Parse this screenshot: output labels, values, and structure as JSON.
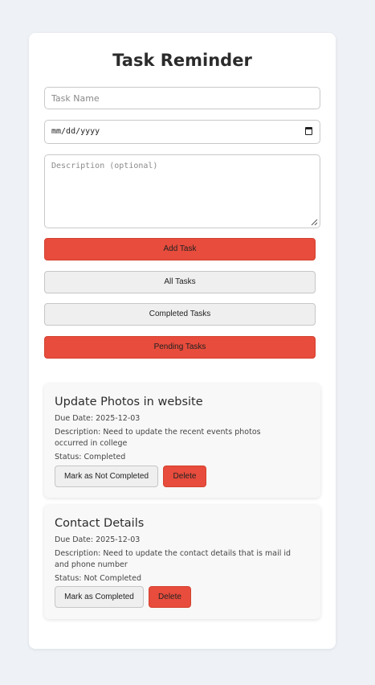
{
  "app": {
    "title": "Task Reminder"
  },
  "form": {
    "task_name_placeholder": "Task Name",
    "date_placeholder": "mm/dd/yyyy",
    "description_placeholder": "Description (optional)",
    "add_task_label": "Add Task"
  },
  "filters": {
    "all_label": "All Tasks",
    "completed_label": "Completed Tasks",
    "pending_label": "Pending Tasks"
  },
  "tasks": [
    {
      "name": "Update Photos in website",
      "due": "Due Date: 2025-12-03",
      "description": "Description: Need to update the recent events photos occurred in college",
      "status": "Status: Completed",
      "toggle_label": "Mark as Not Completed",
      "delete_label": "Delete"
    },
    {
      "name": "Contact Details",
      "due": "Due Date: 2025-12-03",
      "description": "Description: Need to update the contact details that is mail id and phone number",
      "status": "Status: Not Completed",
      "toggle_label": "Mark as Completed",
      "delete_label": "Delete"
    }
  ],
  "colors": {
    "accent_red": "#e74c3c",
    "page_background": "#eef1f6",
    "button_gray": "#efefef"
  }
}
